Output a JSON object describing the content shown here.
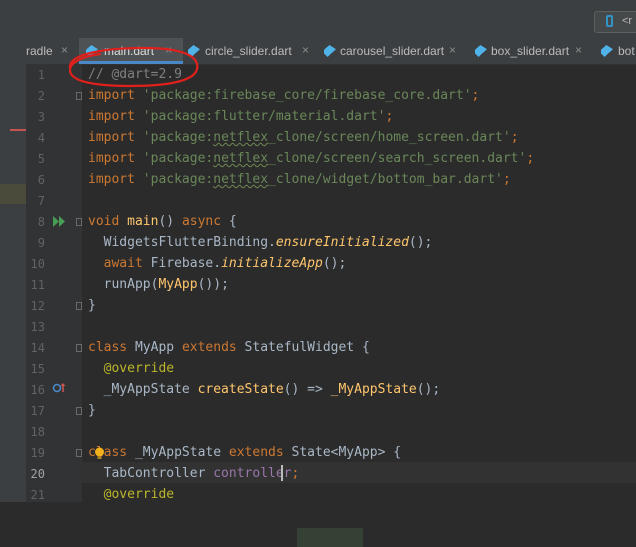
{
  "toolbar": {
    "run_config_label": "<r"
  },
  "tabs": [
    {
      "label": "radle",
      "active": false
    },
    {
      "label": "main.dart",
      "active": true
    },
    {
      "label": "circle_slider.dart",
      "active": false
    },
    {
      "label": "carousel_slider.dart",
      "active": false
    },
    {
      "label": "box_slider.dart",
      "active": false
    },
    {
      "label": "bot",
      "active": false
    }
  ],
  "tab_close_glyph": "×",
  "gutter": {
    "line_numbers": [
      "1",
      "2",
      "3",
      "4",
      "5",
      "6",
      "7",
      "8",
      "9",
      "10",
      "11",
      "12",
      "13",
      "14",
      "15",
      "16",
      "17",
      "18",
      "19",
      "20",
      "21"
    ],
    "current_line": "20"
  },
  "code": {
    "l1": "// @dart=2.9",
    "l2_kw": "import",
    "l2_str": "'package:firebase_core/firebase_core.dart'",
    "l2_end": ";",
    "l3_kw": "import",
    "l3_str": "'package:flutter/material.dart'",
    "l3_end": ";",
    "l4_kw": "import",
    "l4_a": "'package:",
    "l4_typo": "netflex",
    "l4_b": "_clone/screen/home_screen.dart'",
    "l4_end": ";",
    "l5_kw": "import",
    "l5_a": "'package:",
    "l5_typo": "netflex",
    "l5_b": "_clone/screen/search_screen.dart'",
    "l5_end": ";",
    "l6_kw": "import",
    "l6_a": "'package:",
    "l6_typo": "netflex",
    "l6_b": "_clone/widget/bottom_bar.dart'",
    "l6_end": ";",
    "l8_kw": "void",
    "l8_fn": "main",
    "l8_mid": "() ",
    "l8_kw2": "async",
    "l8_end": " {",
    "l9_a": "WidgetsFlutterBinding.",
    "l9_fn": "ensureInitialized",
    "l9_end": "();",
    "l10_kw": "await",
    "l10_a": " Firebase.",
    "l10_fn": "initializeApp",
    "l10_end": "();",
    "l11_a": "runApp(",
    "l11_fn": "MyApp",
    "l11_end": "());",
    "l12": "}",
    "l14_kw": "class",
    "l14_a": " MyApp ",
    "l14_kw2": "extends",
    "l14_end": " StatefulWidget {",
    "l15": "@override",
    "l16_a": "_MyAppState ",
    "l16_fn": "createState",
    "l16_mid": "() => ",
    "l16_fn2": "_MyAppState",
    "l16_end": "();",
    "l17": "}",
    "l19_kw": "class",
    "l19_a": " _MyAppState ",
    "l19_kw2": "extends",
    "l19_end": " State<MyApp> {",
    "l20_a": "TabController ",
    "l20_field": "controller",
    "l20_end": ";",
    "l21": "@override"
  },
  "colors": {
    "keyword": "#cc7832",
    "string": "#6a8759",
    "comment": "#808080",
    "function": "#ffc66d",
    "annotation": "#bbb529",
    "field": "#9876aa",
    "circle": "#e0201c"
  }
}
